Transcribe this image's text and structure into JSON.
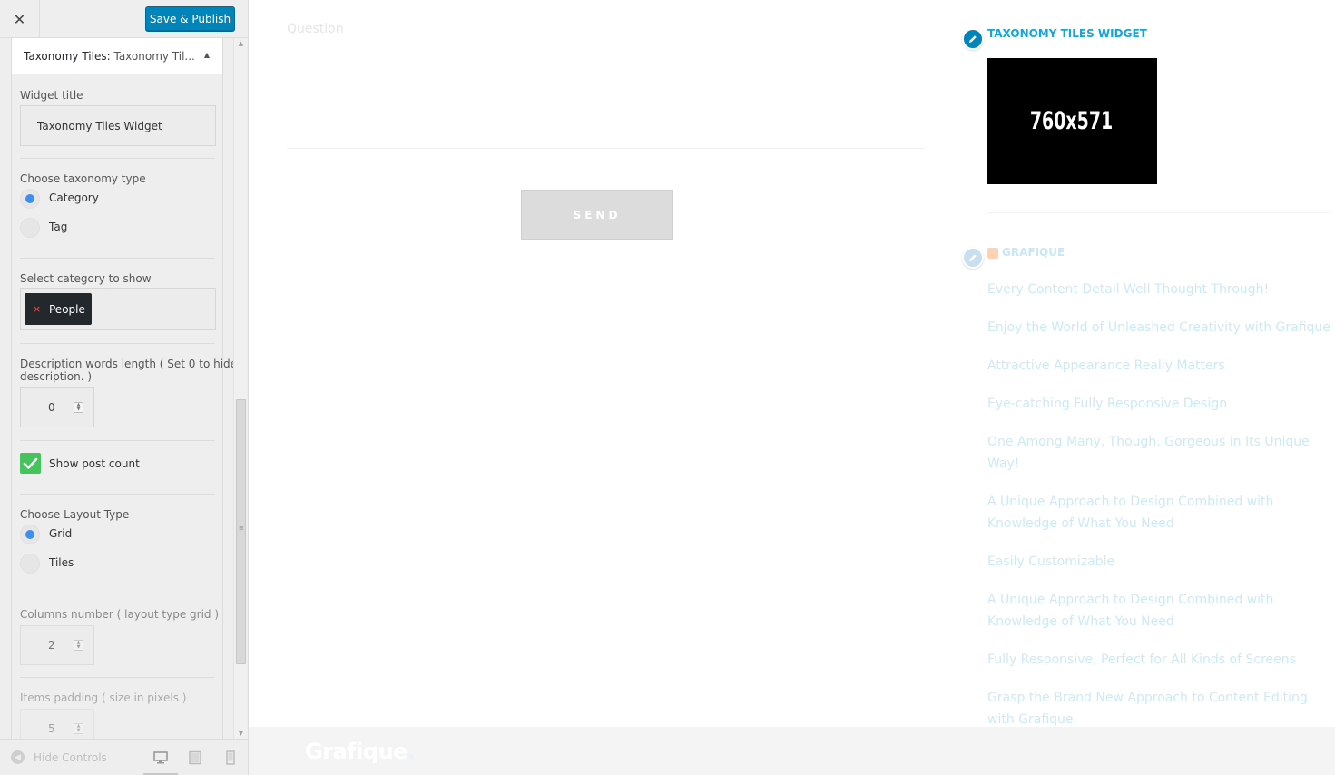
{
  "sidebar": {
    "close_label": "✕",
    "save_label": "Save & Publish",
    "widget_header": {
      "title": "Taxonomy Tiles:",
      "subtitle": "Taxonomy Til...",
      "toggle": "▲"
    },
    "widget_title": {
      "label": "Widget title",
      "value": "Taxonomy Tiles Widget"
    },
    "taxonomy_type": {
      "label": "Choose taxonomy type",
      "options": [
        {
          "label": "Category",
          "selected": true
        },
        {
          "label": "Tag",
          "selected": false
        }
      ]
    },
    "category": {
      "label": "Select category to show",
      "tag_remove": "×",
      "tag_label": "People"
    },
    "description_length": {
      "label_line1": "Description words length ( Set 0 to hide",
      "label_line2": "description. )",
      "value": "0"
    },
    "show_post_count": {
      "label": "Show post count",
      "checked": true
    },
    "layout_type": {
      "label": "Choose Layout Type",
      "options": [
        {
          "label": "Grid",
          "selected": true
        },
        {
          "label": "Tiles",
          "selected": false
        }
      ]
    },
    "columns": {
      "label": "Columns number ( layout type grid )",
      "value": "2"
    },
    "padding": {
      "label": "Items padding ( size in pixels )",
      "value": "5"
    },
    "footer": {
      "hide_controls": "Hide Controls"
    }
  },
  "preview": {
    "question_placeholder": "Question",
    "send_label": "SEND",
    "taxonomy_widget": {
      "title": "TAXONOMY TILES WIDGET",
      "image_text": "760x571"
    },
    "rss_widget": {
      "title": "GRAFIQUE",
      "items": [
        "Every Content Detail Well Thought Through!",
        "Enjoy the World of Unleashed Creativity with Grafique",
        "Attractive Appearance Really Matters",
        "Eye-catching Fully Responsive Design",
        "One Among Many, Though, Gorgeous in Its Unique Way!",
        "A Unique Approach to Design Combined with Knowledge of What You Need",
        "Easily Customizable",
        "A Unique Approach to Design Combined with Knowledge of What You Need",
        "Fully Responsive, Perfect for All Kinds of Screens",
        "Grasp the Brand New Approach to Content Editing with Grafique"
      ]
    },
    "footer_logo": "Grafique",
    "footer_logo_dot": "."
  },
  "colors": {
    "primary_button": "#0085ba",
    "accent_radio": "#3b8ff0",
    "checkbox": "#45c35c",
    "widget_title": "#17a4d9"
  }
}
